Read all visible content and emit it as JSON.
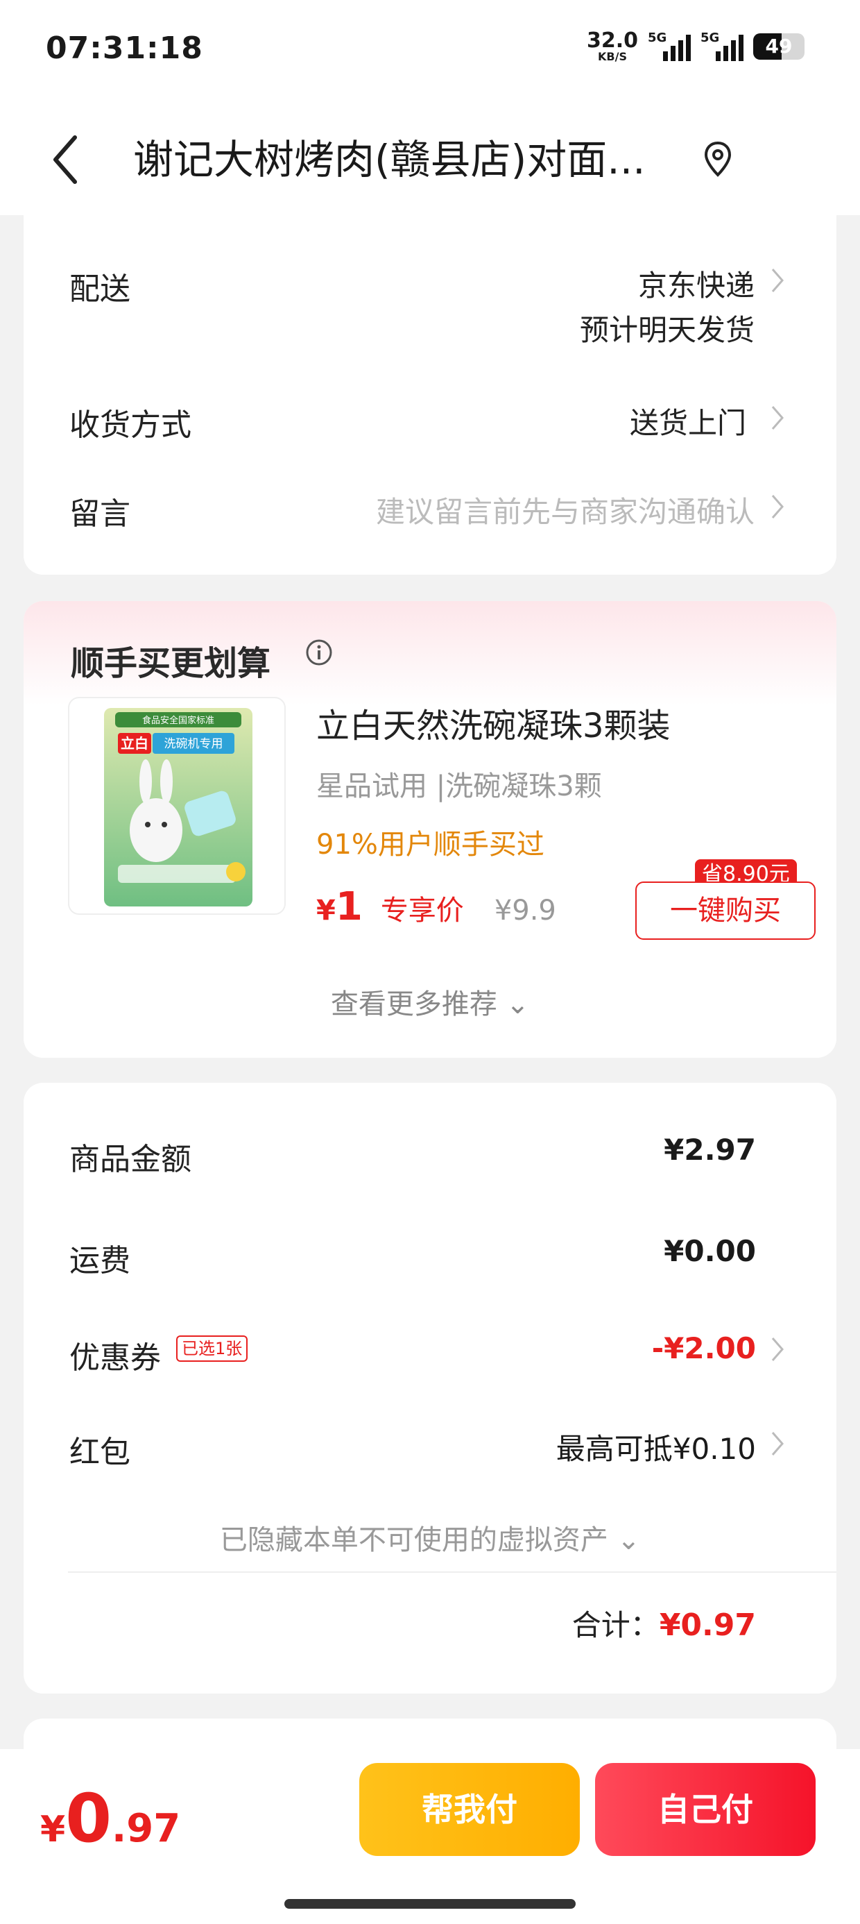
{
  "status_bar": {
    "time": "07:31:18",
    "net_speed": "32.0",
    "net_unit": "KB/S",
    "signal1": "5G",
    "signal2": "5G",
    "battery": "49"
  },
  "header": {
    "title": "谢记大树烤肉(赣县店)对面..."
  },
  "delivery": {
    "shipping_label": "配送",
    "shipping_value": "京东快递",
    "shipping_eta": "预计明天发货",
    "method_label": "收货方式",
    "method_value": "送货上门",
    "note_label": "留言",
    "note_placeholder": "建议留言前先与商家沟通确认"
  },
  "recommend": {
    "title": "顺手买更划算",
    "product_name": "立白天然洗碗凝珠3颗装",
    "product_sub": "星品试用 |洗碗凝珠3颗",
    "product_tip": "91%用户顺手买过",
    "price_currency": "¥",
    "price": "1",
    "price_label": "专享价",
    "original_price": "¥9.9",
    "save_badge": "省8.90元",
    "buy_button": "一键购买",
    "more": "查看更多推荐 ⌄",
    "image_brand": "立白",
    "image_banner": "洗碗机专用",
    "image_top": "食品安全国家标准"
  },
  "summary": {
    "goods_label": "商品金额",
    "goods_value": "¥2.97",
    "freight_label": "运费",
    "freight_value": "¥0.00",
    "coupon_label": "优惠券",
    "coupon_tag": "已选1张",
    "coupon_value": "-¥2.00",
    "redpacket_label": "红包",
    "redpacket_value": "最高可抵¥0.10",
    "hidden_assets": "已隐藏本单不可使用的虚拟资产 ⌄",
    "total_label": "合计：",
    "total_value": "¥0.97"
  },
  "bottom": {
    "currency": "¥",
    "amount_int": "0",
    "amount_dec": ".97",
    "help_pay": "帮我付",
    "self_pay": "自己付"
  },
  "colors": {
    "accent_red": "#e8201f",
    "accent_yellow": "#ffc21a",
    "tip_orange": "#e3870b"
  }
}
